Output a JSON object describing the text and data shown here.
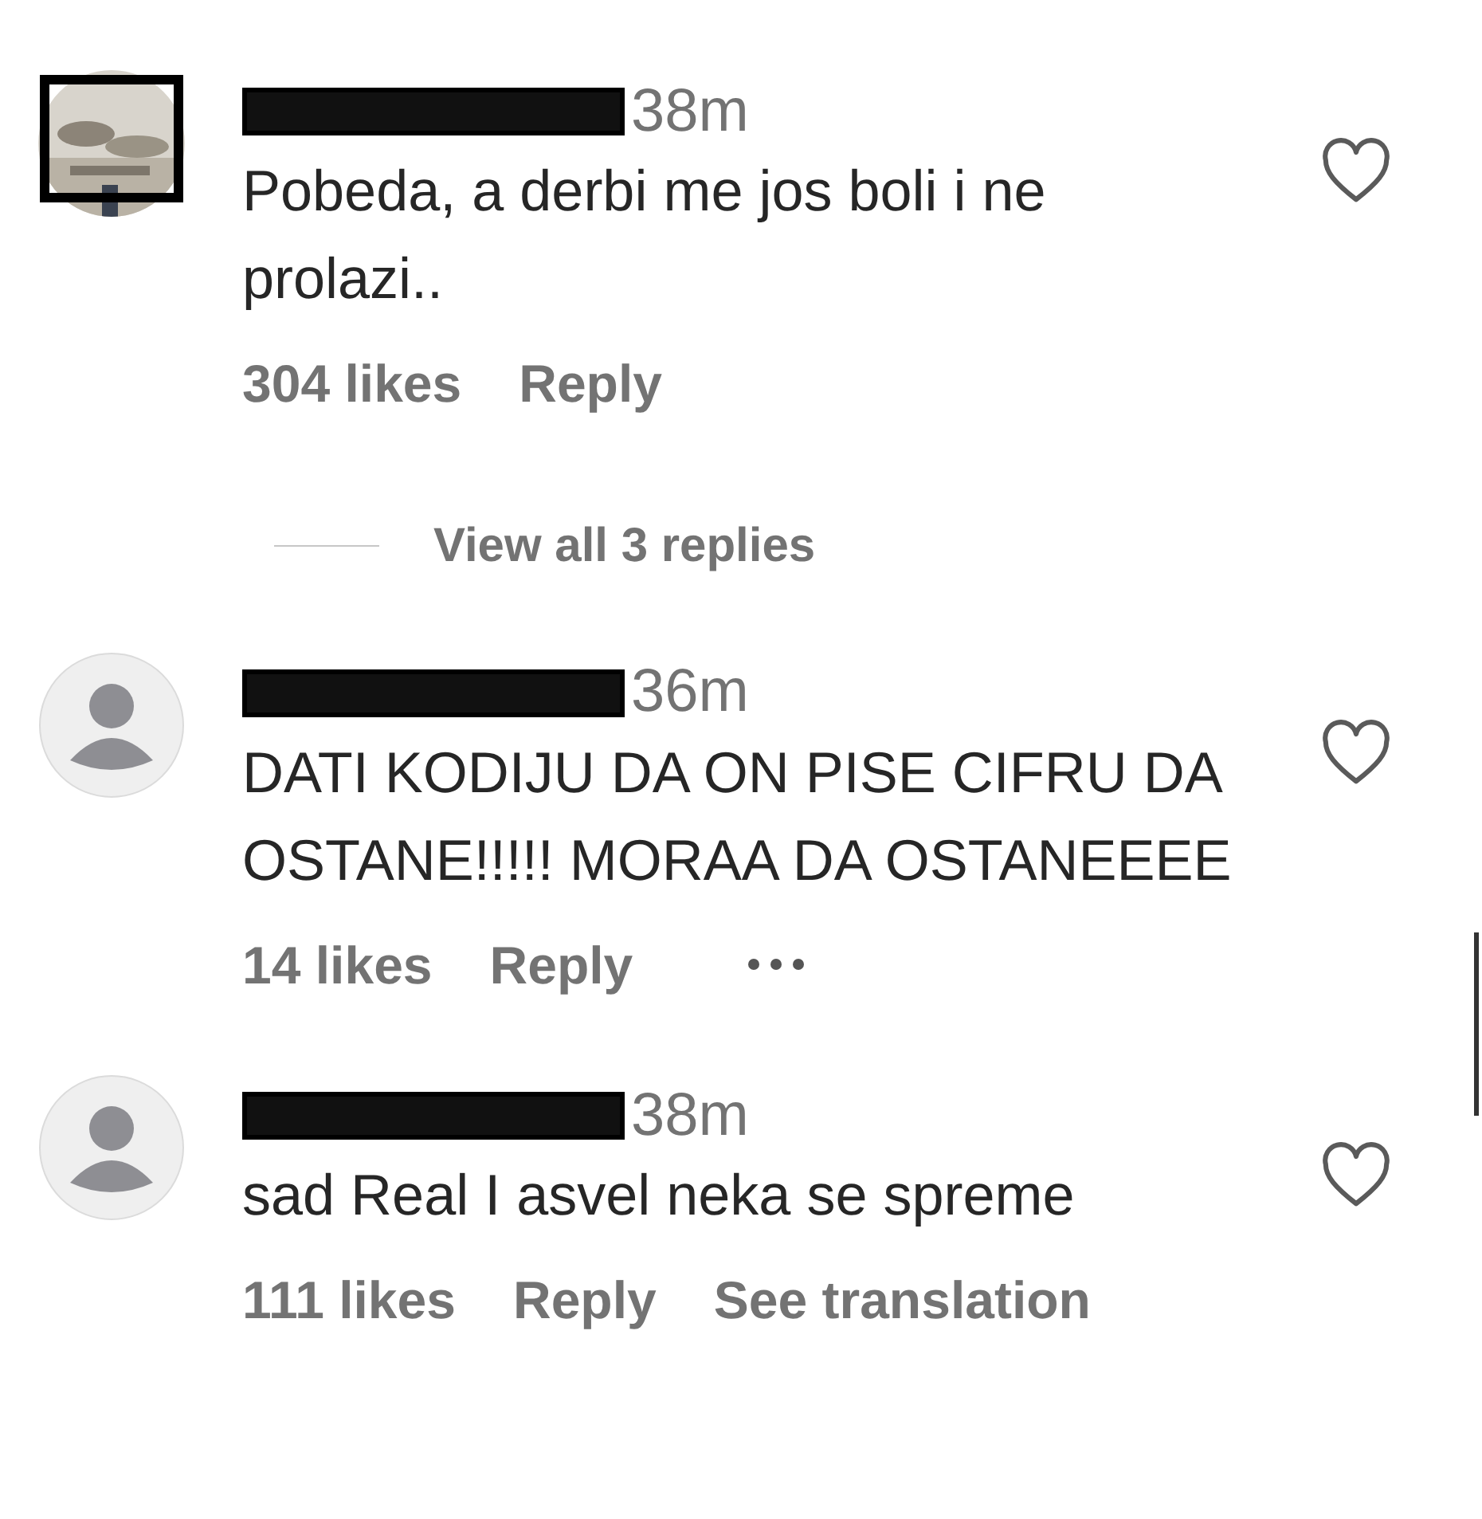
{
  "comments": [
    {
      "time": "38m",
      "text": "Pobeda, a derbi me jos boli i ne prolazi..",
      "likes": "304 likes",
      "reply": "Reply",
      "more": false,
      "view_replies": "View all 3 replies"
    },
    {
      "kind": "plain",
      "time": "36m",
      "text": "DATI KODIJU DA ON PISE CIFRU DA OSTANE!!!!! MORAA DA OSTANEEEE",
      "likes": "14 likes",
      "reply": "Reply",
      "more": true
    },
    {
      "kind": "plain",
      "time": "38m",
      "text": "sad Real I asvel neka se spreme",
      "likes": "111 likes",
      "reply": "Reply",
      "more": false,
      "translation": "See translation"
    }
  ]
}
